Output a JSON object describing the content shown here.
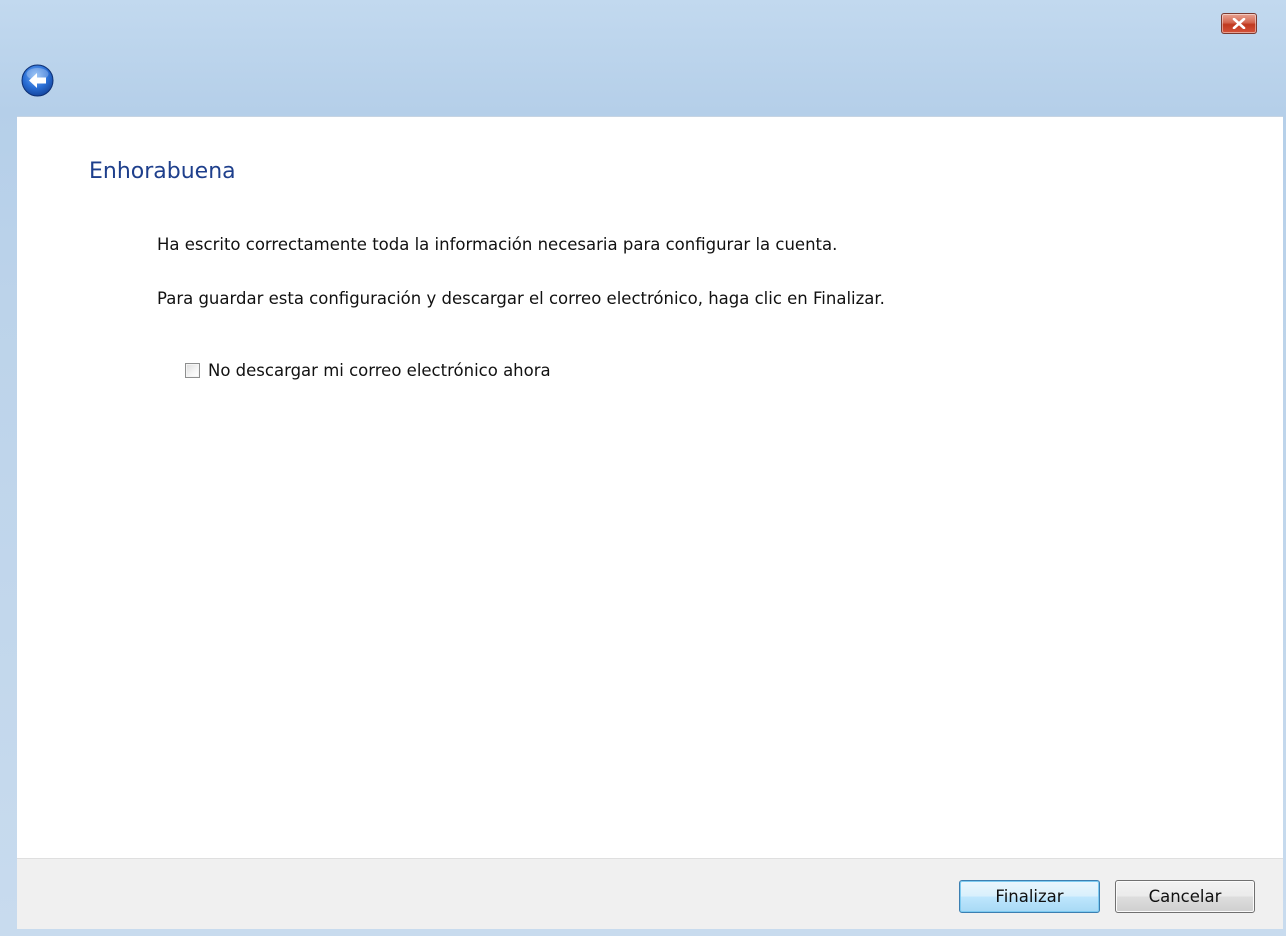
{
  "window": {
    "close_icon": "close-icon",
    "back_icon": "back-arrow-icon"
  },
  "content": {
    "heading": "Enhorabuena",
    "paragraph_1": "Ha escrito correctamente toda la información necesaria para configurar la cuenta.",
    "paragraph_2": "Para guardar esta configuración y descargar el correo electrónico, haga clic en Finalizar.",
    "checkbox_label": "No descargar mi correo electrónico ahora",
    "checkbox_checked": false
  },
  "footer": {
    "finish_label": "Finalizar",
    "cancel_label": "Cancelar"
  },
  "colors": {
    "heading": "#1e3f8c",
    "close_button": "#c0391f",
    "back_button": "#2a6fd6",
    "primary_button_border": "#3c7fb1"
  }
}
